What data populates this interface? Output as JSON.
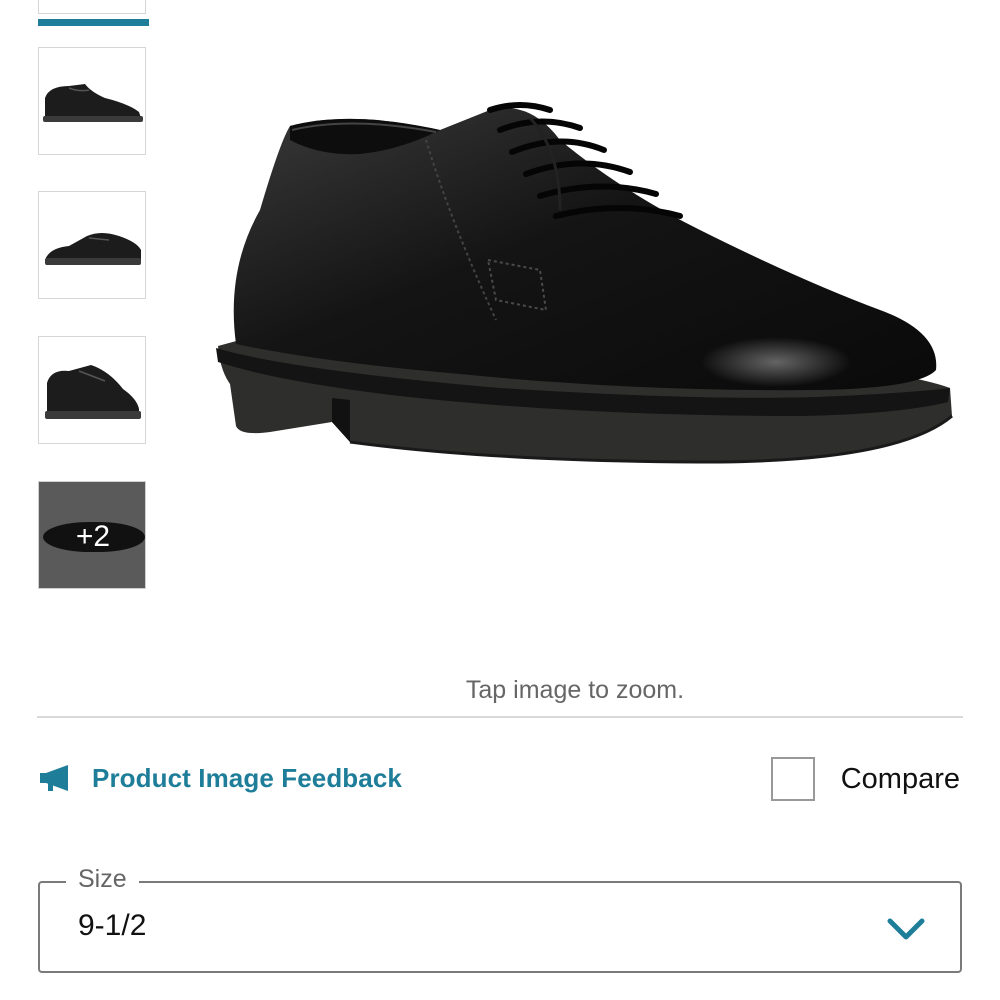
{
  "gallery": {
    "thumbnails": [
      {
        "icon": "shoe-side-view-icon"
      },
      {
        "icon": "shoe-angle-view-icon"
      },
      {
        "icon": "shoe-back-angle-icon"
      }
    ],
    "more_label": "+2",
    "main_image_icon": "black-leather-oxford-shoe",
    "zoom_hint": "Tap image to zoom."
  },
  "actions": {
    "feedback_label": "Product Image Feedback",
    "feedback_icon": "megaphone-icon",
    "compare_label": "Compare",
    "compare_checked": false
  },
  "size_select": {
    "label": "Size",
    "value": "9-1/2",
    "chevron_icon": "chevron-down-icon"
  },
  "colors": {
    "accent": "#1e7e99",
    "border": "#7a7a7a",
    "divider": "#d9d9d9"
  }
}
